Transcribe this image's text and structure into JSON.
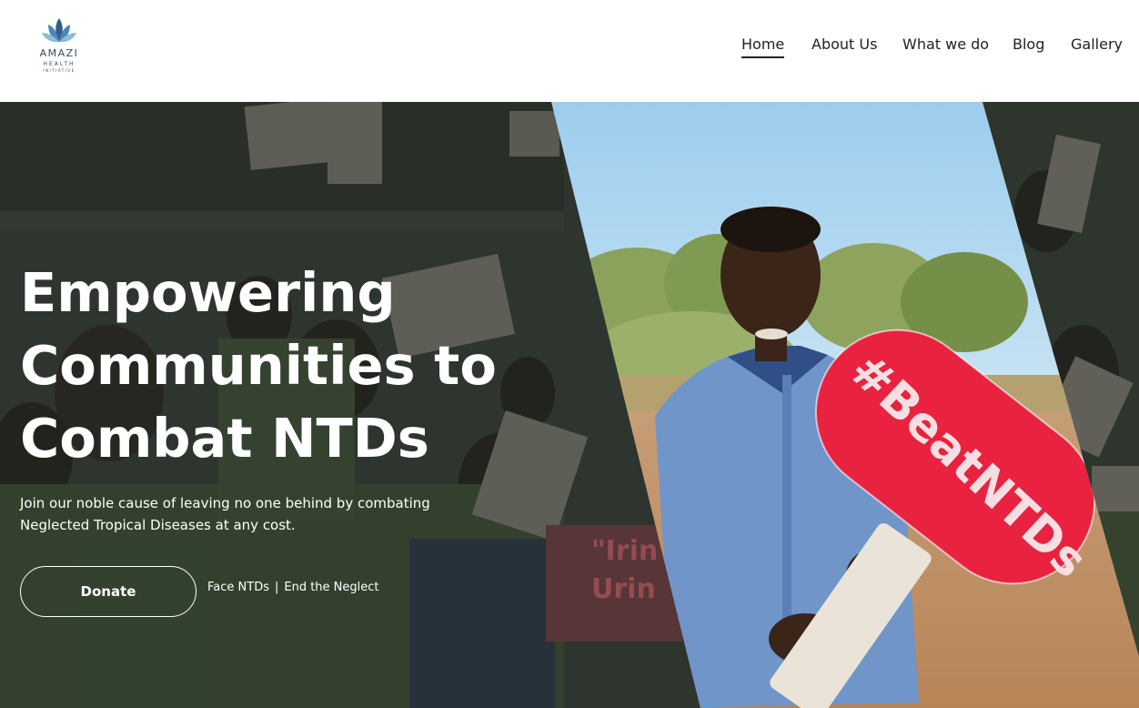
{
  "brand": {
    "name": "AMAZI",
    "sub": "HEALTH",
    "sub2": "INITIATIVE"
  },
  "nav": {
    "items": [
      "Home",
      "About Us",
      "What we do",
      "Blog",
      "Gallery"
    ],
    "active": "Home"
  },
  "hero": {
    "headline_lines": [
      "Empowering",
      "Communities to",
      "Combat NTDs"
    ],
    "subtext_lines": [
      "Join our noble cause of leaving no one behind by combating",
      "Neglected Tropical Diseases at any cost."
    ],
    "donate_label": "Donate",
    "tagline_left": "Face NTDs",
    "tagline_sep": "|",
    "tagline_right": "End the Neglect",
    "sign_text": "#BeatNTDs",
    "banner_text_1": "\"Irin",
    "banner_text_2": "Urin"
  },
  "colors": {
    "sign_red": "#e8223f",
    "overlay": "#1b1f1d",
    "sky": "#b9daf0",
    "shirt": "#6f95c9"
  }
}
